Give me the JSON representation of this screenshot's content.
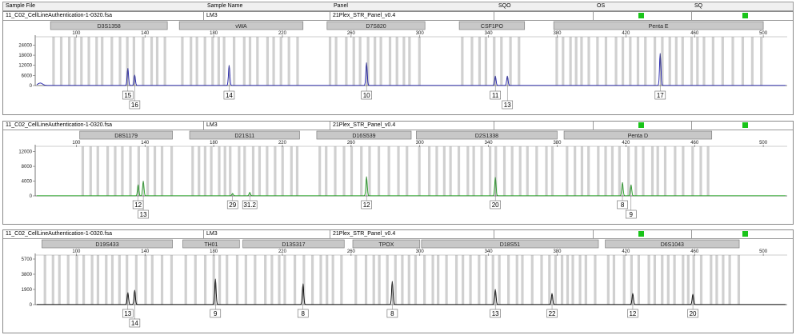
{
  "header": {
    "col_sample_file": "Sample File",
    "col_sample_name": "Sample Name",
    "col_panel": "Panel",
    "col_sqo": "SQO",
    "col_os": "OS",
    "col_sq": "SQ"
  },
  "colors": {
    "blue": "#1a1aa8",
    "green": "#22a022",
    "black": "#000000",
    "bin": "#d0d0d0",
    "status": "#19c419"
  },
  "panels": [
    {
      "file": "11_C02_CellLineAuthentication-1-0320.fsa",
      "name": "LM3",
      "panel": "21Plex_STR_Panel_v0.4",
      "color": "blue"
    },
    {
      "file": "11_C02_CellLineAuthentication-1-0320.fsa",
      "name": "LM3",
      "panel": "21Plex_STR_Panel_v0.4",
      "color": "green"
    },
    {
      "file": "11_C02_CellLineAuthentication-1-0320.fsa",
      "name": "LM3",
      "panel": "21Plex_STR_Panel_v0.4",
      "color": "black"
    }
  ],
  "chart_data": [
    {
      "type": "line",
      "dye": "blue",
      "xlim": [
        77,
        513
      ],
      "x_ticks": [
        100,
        140,
        180,
        220,
        260,
        300,
        340,
        380,
        420,
        460,
        500
      ],
      "ylim": [
        0,
        28000
      ],
      "y_ticks": [
        0,
        6000,
        12000,
        18000,
        24000
      ],
      "loci": [
        {
          "name": "D3S1358",
          "start": 85,
          "end": 153
        },
        {
          "name": "vWA",
          "start": 160,
          "end": 232
        },
        {
          "name": "D7S820",
          "start": 246,
          "end": 303
        },
        {
          "name": "CSF1PO",
          "start": 323,
          "end": 361
        },
        {
          "name": "Penta E",
          "start": 378,
          "end": 500
        }
      ],
      "peaks": [
        {
          "x": 130,
          "height": 10200,
          "allele": "15"
        },
        {
          "x": 134,
          "height": 6200,
          "allele": "16"
        },
        {
          "x": 189,
          "height": 12000,
          "allele": "14"
        },
        {
          "x": 269,
          "height": 13500,
          "allele": "10"
        },
        {
          "x": 344,
          "height": 5600,
          "allele": "11"
        },
        {
          "x": 351,
          "height": 5600,
          "allele": "13"
        },
        {
          "x": 440,
          "height": 19000,
          "allele": "17"
        }
      ]
    },
    {
      "type": "line",
      "dye": "green",
      "xlim": [
        77,
        513
      ],
      "x_ticks": [
        100,
        140,
        180,
        220,
        260,
        300,
        340,
        380,
        420,
        460,
        500
      ],
      "ylim": [
        0,
        13000
      ],
      "y_ticks": [
        0,
        4000,
        8000,
        12000
      ],
      "loci": [
        {
          "name": "D8S1179",
          "start": 102,
          "end": 156
        },
        {
          "name": "D21S11",
          "start": 166,
          "end": 230
        },
        {
          "name": "D16S539",
          "start": 240,
          "end": 295
        },
        {
          "name": "D2S1338",
          "start": 298,
          "end": 380
        },
        {
          "name": "Penta D",
          "start": 384,
          "end": 470
        }
      ],
      "peaks": [
        {
          "x": 136,
          "height": 3000,
          "allele": "12"
        },
        {
          "x": 139,
          "height": 4000,
          "allele": "13"
        },
        {
          "x": 191,
          "height": 600,
          "allele": "29"
        },
        {
          "x": 201,
          "height": 900,
          "allele": "31.2"
        },
        {
          "x": 269,
          "height": 5200,
          "allele": "12"
        },
        {
          "x": 344,
          "height": 5000,
          "allele": "20"
        },
        {
          "x": 418,
          "height": 3600,
          "allele": "8"
        },
        {
          "x": 423,
          "height": 3000,
          "allele": "9"
        }
      ]
    },
    {
      "type": "line",
      "dye": "black",
      "xlim": [
        77,
        513
      ],
      "x_ticks": [
        100,
        140,
        180,
        220,
        260,
        300,
        340,
        380,
        420,
        460,
        500
      ],
      "ylim": [
        0,
        6000
      ],
      "y_ticks": [
        0,
        1900,
        3800,
        5700
      ],
      "y_tick_labels": [
        "0",
        "1900",
        "3800",
        "5700"
      ],
      "loci": [
        {
          "name": "D19S433",
          "start": 80,
          "end": 156
        },
        {
          "name": "TH01",
          "start": 162,
          "end": 195
        },
        {
          "name": "D13S317",
          "start": 197,
          "end": 256
        },
        {
          "name": "TPOX",
          "start": 261,
          "end": 300
        },
        {
          "name": "D18S51",
          "start": 301,
          "end": 404
        },
        {
          "name": "D6S1043",
          "start": 408,
          "end": 486
        }
      ],
      "peaks": [
        {
          "x": 130,
          "height": 1500,
          "allele": "13"
        },
        {
          "x": 134,
          "height": 1800,
          "allele": "14"
        },
        {
          "x": 181,
          "height": 3200,
          "allele": "9"
        },
        {
          "x": 232,
          "height": 2600,
          "allele": "8"
        },
        {
          "x": 284,
          "height": 2900,
          "allele": "8"
        },
        {
          "x": 344,
          "height": 1900,
          "allele": "13"
        },
        {
          "x": 377,
          "height": 1400,
          "allele": "22"
        },
        {
          "x": 424,
          "height": 1400,
          "allele": "12"
        },
        {
          "x": 459,
          "height": 1300,
          "allele": "20"
        }
      ]
    }
  ]
}
